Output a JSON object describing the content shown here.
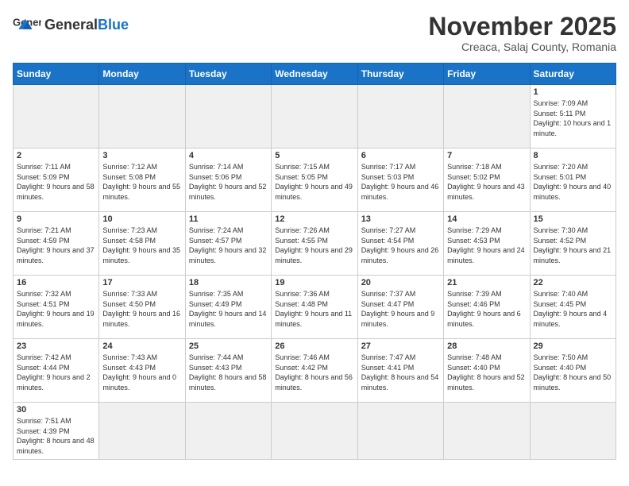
{
  "logo": {
    "text_general": "General",
    "text_blue": "Blue"
  },
  "title": {
    "month_year": "November 2025",
    "location": "Creaca, Salaj County, Romania"
  },
  "weekdays": [
    "Sunday",
    "Monday",
    "Tuesday",
    "Wednesday",
    "Thursday",
    "Friday",
    "Saturday"
  ],
  "days": {
    "1": {
      "num": "1",
      "sunrise": "7:09 AM",
      "sunset": "5:11 PM",
      "daylight": "10 hours and 1 minute."
    },
    "2": {
      "num": "2",
      "sunrise": "7:11 AM",
      "sunset": "5:09 PM",
      "daylight": "9 hours and 58 minutes."
    },
    "3": {
      "num": "3",
      "sunrise": "7:12 AM",
      "sunset": "5:08 PM",
      "daylight": "9 hours and 55 minutes."
    },
    "4": {
      "num": "4",
      "sunrise": "7:14 AM",
      "sunset": "5:06 PM",
      "daylight": "9 hours and 52 minutes."
    },
    "5": {
      "num": "5",
      "sunrise": "7:15 AM",
      "sunset": "5:05 PM",
      "daylight": "9 hours and 49 minutes."
    },
    "6": {
      "num": "6",
      "sunrise": "7:17 AM",
      "sunset": "5:03 PM",
      "daylight": "9 hours and 46 minutes."
    },
    "7": {
      "num": "7",
      "sunrise": "7:18 AM",
      "sunset": "5:02 PM",
      "daylight": "9 hours and 43 minutes."
    },
    "8": {
      "num": "8",
      "sunrise": "7:20 AM",
      "sunset": "5:01 PM",
      "daylight": "9 hours and 40 minutes."
    },
    "9": {
      "num": "9",
      "sunrise": "7:21 AM",
      "sunset": "4:59 PM",
      "daylight": "9 hours and 37 minutes."
    },
    "10": {
      "num": "10",
      "sunrise": "7:23 AM",
      "sunset": "4:58 PM",
      "daylight": "9 hours and 35 minutes."
    },
    "11": {
      "num": "11",
      "sunrise": "7:24 AM",
      "sunset": "4:57 PM",
      "daylight": "9 hours and 32 minutes."
    },
    "12": {
      "num": "12",
      "sunrise": "7:26 AM",
      "sunset": "4:55 PM",
      "daylight": "9 hours and 29 minutes."
    },
    "13": {
      "num": "13",
      "sunrise": "7:27 AM",
      "sunset": "4:54 PM",
      "daylight": "9 hours and 26 minutes."
    },
    "14": {
      "num": "14",
      "sunrise": "7:29 AM",
      "sunset": "4:53 PM",
      "daylight": "9 hours and 24 minutes."
    },
    "15": {
      "num": "15",
      "sunrise": "7:30 AM",
      "sunset": "4:52 PM",
      "daylight": "9 hours and 21 minutes."
    },
    "16": {
      "num": "16",
      "sunrise": "7:32 AM",
      "sunset": "4:51 PM",
      "daylight": "9 hours and 19 minutes."
    },
    "17": {
      "num": "17",
      "sunrise": "7:33 AM",
      "sunset": "4:50 PM",
      "daylight": "9 hours and 16 minutes."
    },
    "18": {
      "num": "18",
      "sunrise": "7:35 AM",
      "sunset": "4:49 PM",
      "daylight": "9 hours and 14 minutes."
    },
    "19": {
      "num": "19",
      "sunrise": "7:36 AM",
      "sunset": "4:48 PM",
      "daylight": "9 hours and 11 minutes."
    },
    "20": {
      "num": "20",
      "sunrise": "7:37 AM",
      "sunset": "4:47 PM",
      "daylight": "9 hours and 9 minutes."
    },
    "21": {
      "num": "21",
      "sunrise": "7:39 AM",
      "sunset": "4:46 PM",
      "daylight": "9 hours and 6 minutes."
    },
    "22": {
      "num": "22",
      "sunrise": "7:40 AM",
      "sunset": "4:45 PM",
      "daylight": "9 hours and 4 minutes."
    },
    "23": {
      "num": "23",
      "sunrise": "7:42 AM",
      "sunset": "4:44 PM",
      "daylight": "9 hours and 2 minutes."
    },
    "24": {
      "num": "24",
      "sunrise": "7:43 AM",
      "sunset": "4:43 PM",
      "daylight": "9 hours and 0 minutes."
    },
    "25": {
      "num": "25",
      "sunrise": "7:44 AM",
      "sunset": "4:43 PM",
      "daylight": "8 hours and 58 minutes."
    },
    "26": {
      "num": "26",
      "sunrise": "7:46 AM",
      "sunset": "4:42 PM",
      "daylight": "8 hours and 56 minutes."
    },
    "27": {
      "num": "27",
      "sunrise": "7:47 AM",
      "sunset": "4:41 PM",
      "daylight": "8 hours and 54 minutes."
    },
    "28": {
      "num": "28",
      "sunrise": "7:48 AM",
      "sunset": "4:40 PM",
      "daylight": "8 hours and 52 minutes."
    },
    "29": {
      "num": "29",
      "sunrise": "7:50 AM",
      "sunset": "4:40 PM",
      "daylight": "8 hours and 50 minutes."
    },
    "30": {
      "num": "30",
      "sunrise": "7:51 AM",
      "sunset": "4:39 PM",
      "daylight": "8 hours and 48 minutes."
    }
  },
  "labels": {
    "sunrise": "Sunrise:",
    "sunset": "Sunset:",
    "daylight": "Daylight:"
  }
}
